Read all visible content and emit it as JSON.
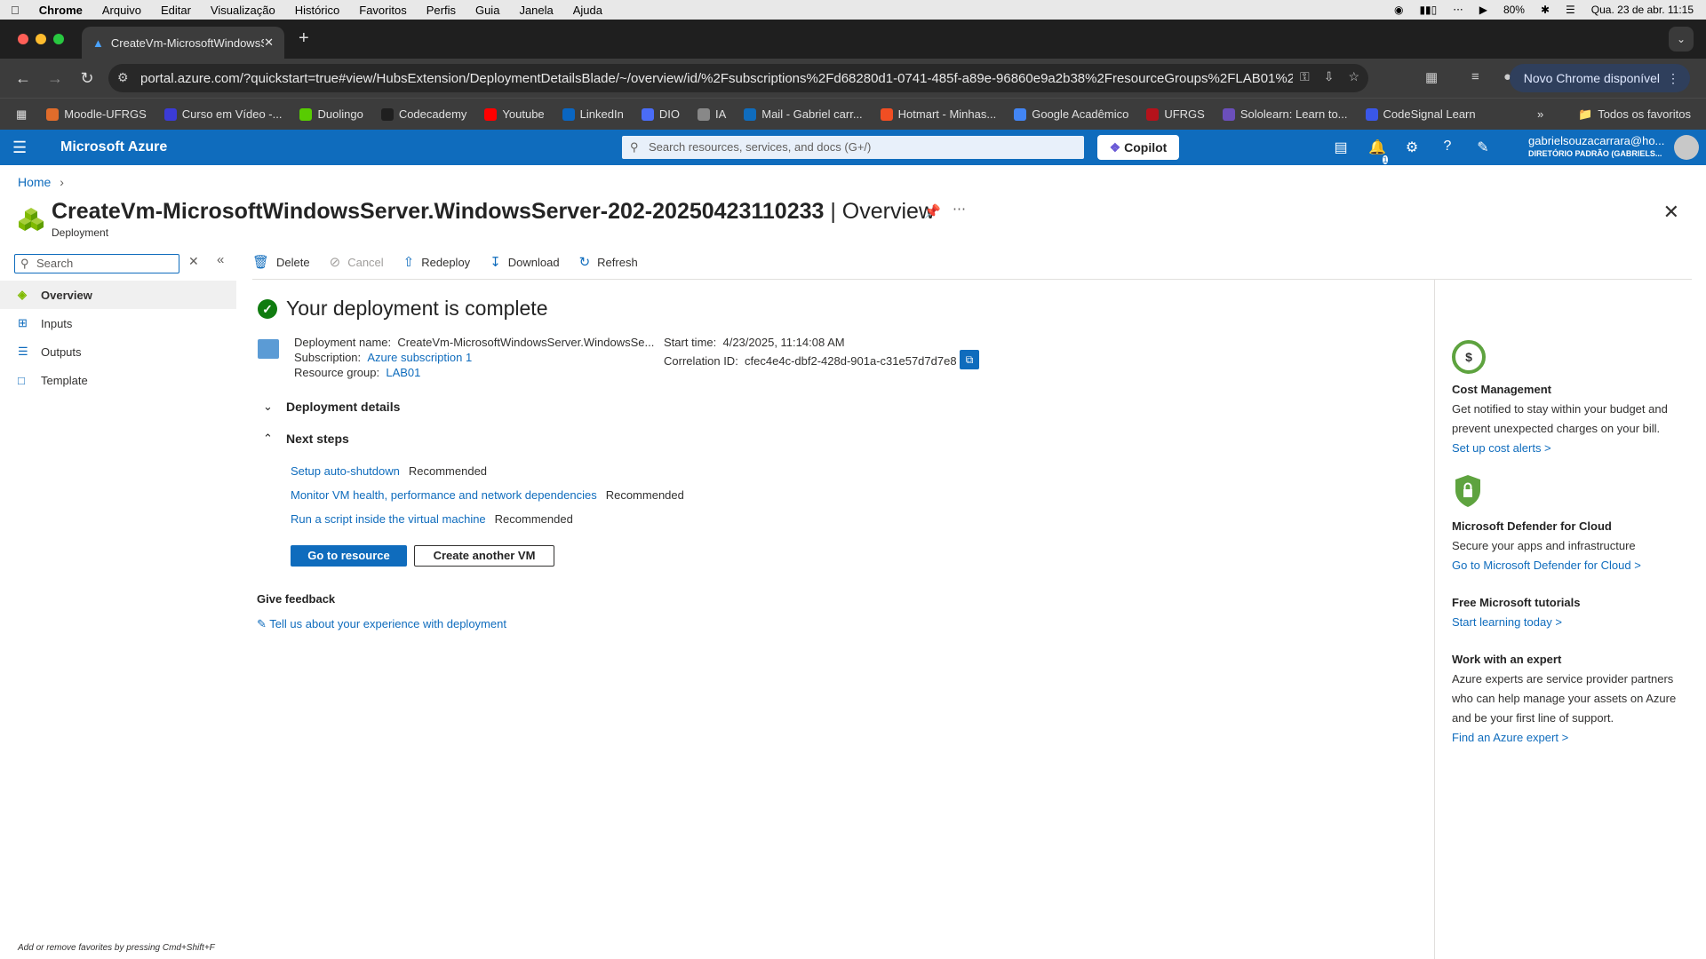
{
  "mac_menu": {
    "apple_icon": "apple-icon",
    "items": [
      "Chrome",
      "Arquivo",
      "Editar",
      "Visualização",
      "Histórico",
      "Favoritos",
      "Perfis",
      "Guia",
      "Janela",
      "Ajuda"
    ],
    "battery": "80%",
    "datetime": "Qua. 23 de abr.  11:15"
  },
  "browser": {
    "tab_title": "CreateVm-MicrosoftWindowsServer.WindowsServer",
    "url": "portal.azure.com/?quickstart=true#view/HubsExtension/DeploymentDetailsBlade/~/overview/id/%2Fsubscriptions%2Fd68280d1-0741-485f-a89e-96860e9a2b38%2FresourceGroups%2FLAB01%2F...",
    "update_button": "Novo Chrome disponível",
    "bookmarks": [
      {
        "label": "Moodle-UFRGS",
        "color": "#e06c2b"
      },
      {
        "label": "Curso em Vídeo -...",
        "color": "#3b3bd6"
      },
      {
        "label": "Duolingo",
        "color": "#58cc02"
      },
      {
        "label": "Codecademy",
        "color": "#1f1f1f"
      },
      {
        "label": "Youtube",
        "color": "#ff0000"
      },
      {
        "label": "LinkedIn",
        "color": "#0a66c2"
      },
      {
        "label": "DIO",
        "color": "#4a6cf7"
      },
      {
        "label": "IA",
        "color": "#888888"
      },
      {
        "label": "Mail - Gabriel carr...",
        "color": "#0f6cbd"
      },
      {
        "label": "Hotmart - Minhas...",
        "color": "#f04e23"
      },
      {
        "label": "Google Acadêmico",
        "color": "#4285f4"
      },
      {
        "label": "UFRGS",
        "color": "#b5121b"
      },
      {
        "label": "Sololearn: Learn to...",
        "color": "#6b4fbb"
      },
      {
        "label": "CodeSignal Learn",
        "color": "#3a57e8"
      }
    ],
    "all_favorites": "Todos os favoritos"
  },
  "azure": {
    "brand": "Microsoft Azure",
    "search_placeholder": "Search resources, services, and docs (G+/)",
    "copilot": "Copilot",
    "notif_count": "1",
    "account_email": "gabrielsouzacarrara@ho...",
    "account_dir": "DIRETÓRIO PADRÃO (GABRIELS..."
  },
  "page": {
    "breadcrumb": "Home",
    "title": "CreateVm-MicrosoftWindowsServer.WindowsServer-202-20250423110233",
    "title_suffix": " | Overview",
    "subtitle": "Deployment"
  },
  "leftnav": {
    "search_placeholder": "Search",
    "items": [
      "Overview",
      "Inputs",
      "Outputs",
      "Template"
    ],
    "footnote": "Add or remove favorites by pressing Cmd+Shift+F"
  },
  "commands": [
    "Delete",
    "Cancel",
    "Redeploy",
    "Download",
    "Refresh"
  ],
  "main": {
    "status": "Your deployment is complete",
    "deployment_name_label": "Deployment name:",
    "deployment_name": "CreateVm-MicrosoftWindowsServer.WindowsSe...",
    "subscription_label": "Subscription:",
    "subscription": "Azure subscription 1",
    "resource_group_label": "Resource group:",
    "resource_group": "LAB01",
    "start_time_label": "Start time:",
    "start_time": "4/23/2025, 11:14:08 AM",
    "correlation_label": "Correlation ID:",
    "correlation_id": "cfec4e4c-dbf2-428d-901a-c31e57d7d7e8",
    "deployment_details": "Deployment details",
    "next_steps": "Next steps",
    "steps": [
      {
        "link": "Setup auto-shutdown",
        "tag": "Recommended"
      },
      {
        "link": "Monitor VM health, performance and network dependencies",
        "tag": "Recommended"
      },
      {
        "link": "Run a script inside the virtual machine",
        "tag": "Recommended"
      }
    ],
    "go_to_resource": "Go to resource",
    "create_another": "Create another VM",
    "feedback_title": "Give feedback",
    "feedback_link": "Tell us about your experience with deployment"
  },
  "right": {
    "cost": {
      "title": "Cost Management",
      "desc": "Get notified to stay within your budget and prevent unexpected charges on your bill.",
      "link": "Set up cost alerts >",
      "icon_text": "$"
    },
    "defender": {
      "title": "Microsoft Defender for Cloud",
      "desc": "Secure your apps and infrastructure",
      "link": "Go to Microsoft Defender for Cloud >"
    },
    "tutorials": {
      "title": "Free Microsoft tutorials",
      "link": "Start learning today >"
    },
    "expert": {
      "title": "Work with an expert",
      "desc": "Azure experts are service provider partners who can help manage your assets on Azure and be your first line of support.",
      "link": "Find an Azure expert >"
    }
  }
}
